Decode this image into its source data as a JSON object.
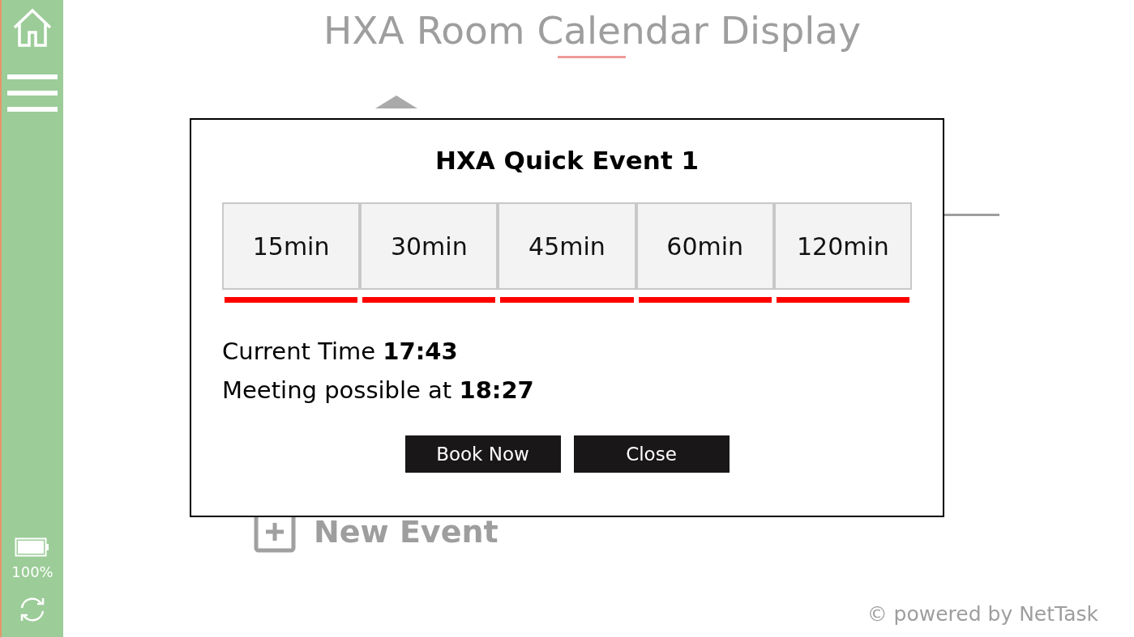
{
  "sidebar": {
    "battery": "100%"
  },
  "page": {
    "title": "HXA Room Calendar Display",
    "new_event": "New Event",
    "footer": "© powered by NetTask"
  },
  "dialog": {
    "title": "HXA Quick Event 1",
    "durations": [
      {
        "label": "15min"
      },
      {
        "label": "30min"
      },
      {
        "label": "45min"
      },
      {
        "label": "60min"
      },
      {
        "label": "120min"
      }
    ],
    "lines": [
      "Current Time **17:43**",
      "Meeting possible at **18:27**"
    ],
    "buttons": [
      "Book Now",
      "Close"
    ]
  }
}
